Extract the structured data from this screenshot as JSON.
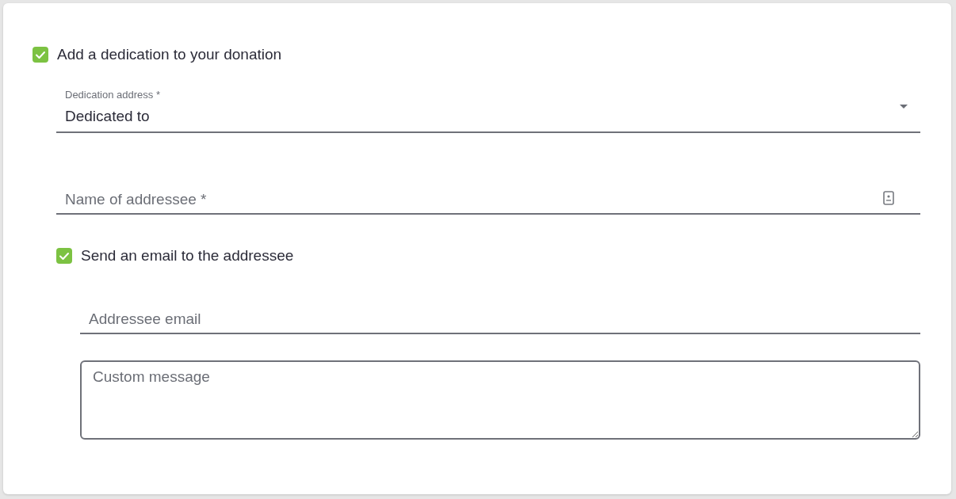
{
  "dedication_checkbox": {
    "label": "Add a dedication to your donation",
    "checked": true
  },
  "address_select": {
    "label": "Dedication address *",
    "value": "Dedicated to"
  },
  "addressee_name": {
    "placeholder": "Name of addressee *"
  },
  "email_checkbox": {
    "label": "Send an email to the addressee",
    "checked": true
  },
  "addressee_email": {
    "placeholder": "Addressee email"
  },
  "custom_message": {
    "placeholder": "Custom message"
  }
}
